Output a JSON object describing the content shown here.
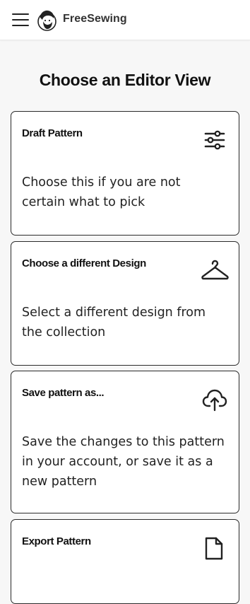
{
  "header": {
    "brand": "FreeSewing",
    "menu_icon": "hamburger-menu-icon",
    "logo_icon": "freesewing-logo-icon"
  },
  "page": {
    "title": "Choose an Editor View"
  },
  "cards": [
    {
      "title": "Draft Pattern",
      "description": "Choose this if you are not certain what to pick",
      "icon": "sliders-icon"
    },
    {
      "title": "Choose a different Design",
      "description": "Select a different design from the collection",
      "icon": "hanger-icon"
    },
    {
      "title": "Save pattern as...",
      "description": "Save the changes to this pattern in your account, or save it as a new pattern",
      "icon": "cloud-upload-icon"
    },
    {
      "title": "Export Pattern",
      "description": "",
      "icon": "document-export-icon"
    }
  ],
  "colors": {
    "background": "#f7f7f7",
    "card_border": "#2a2a2a",
    "text": "#111111"
  }
}
